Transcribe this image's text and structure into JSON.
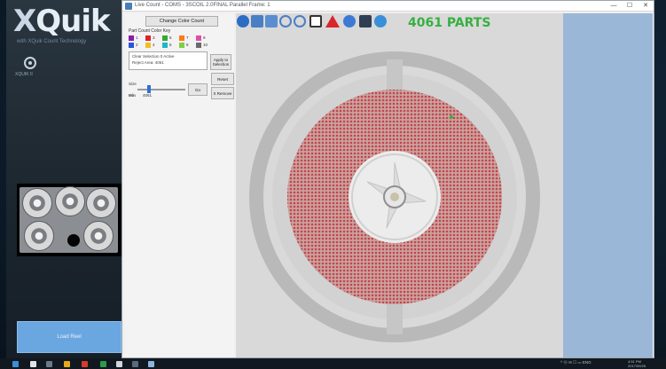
{
  "brand": {
    "name_x": "X",
    "name_rest": "Quik",
    "tagline": "with XQuik Count Technology"
  },
  "side": {
    "icon_label": "XQUIK II",
    "button_label": "Load Reel"
  },
  "window": {
    "title": "Live Count - COMS - 3SCOIL 2.0FINAL Parallel Frame: 1",
    "controls": {
      "minimize": "—",
      "maximize": "☐",
      "close": "✕"
    }
  },
  "controls_panel": {
    "change_button": "Change Color Count",
    "color_key_label": "Part Count Color Key",
    "swatches": [
      {
        "color": "#8a1ca8",
        "label": "1"
      },
      {
        "color": "#2a55d8",
        "label": "2"
      },
      {
        "color": "#e0202a",
        "label": "3"
      },
      {
        "color": "#f0c020",
        "label": "4"
      },
      {
        "color": "#33aa33",
        "label": "5"
      },
      {
        "color": "#1fb6c8",
        "label": "6"
      },
      {
        "color": "#ff7a1a",
        "label": "7"
      },
      {
        "color": "#7fcf3f",
        "label": "8"
      },
      {
        "color": "#e04fa8",
        "label": "9"
      },
      {
        "color": "#6a6a6a",
        "label": "10"
      }
    ],
    "text_lines": [
      "Clear Selection  0 Active",
      "Reject Area: 4061"
    ],
    "apply_button": "Apply to Selection",
    "slider_label": "Size",
    "slider_value": 0.22,
    "button_go": "Go",
    "button_reset": "Reset",
    "button_remove": "X Remove",
    "value_label": "Min",
    "value_text": "4061"
  },
  "toolbar": {
    "icons": [
      "home-icon",
      "save-icon",
      "open-folder-icon",
      "zoom-in-icon",
      "zoom-out-icon",
      "checkbox-icon",
      "warning-icon",
      "cloud-icon",
      "monitor-icon",
      "info-icon"
    ],
    "parts_count": "4061 PARTS"
  },
  "taskbar": {
    "tray_text": "^  ⓦ  ✉  ☐  ▭  ENG",
    "clock_time": "4:51 PM",
    "clock_date": "2017/09/25"
  }
}
